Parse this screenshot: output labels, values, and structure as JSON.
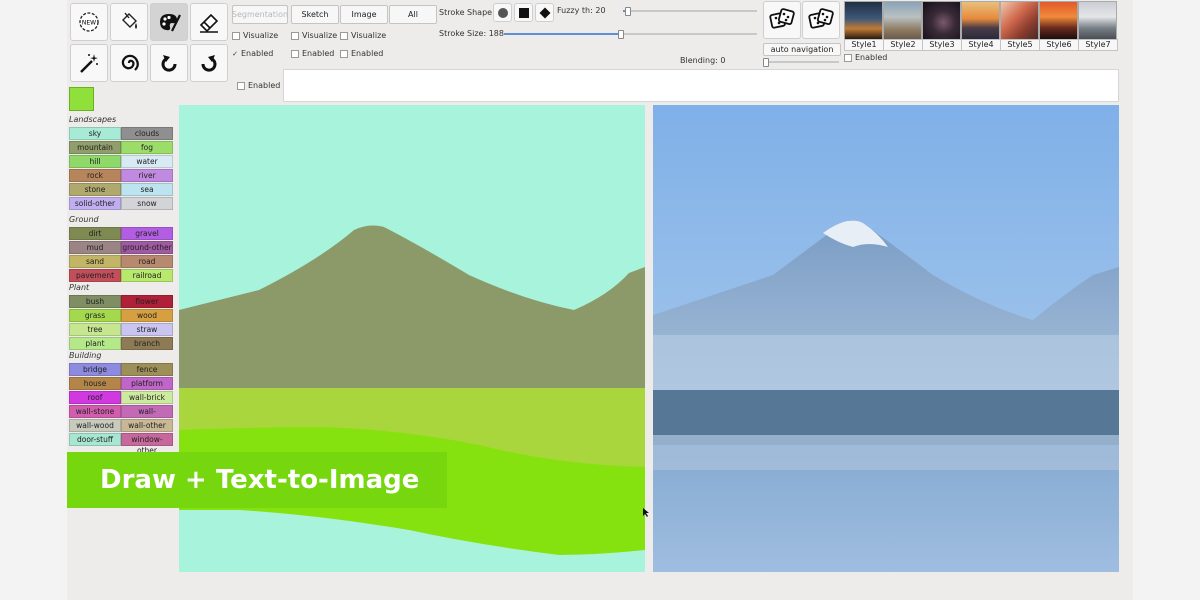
{
  "toolbar": {
    "tools_row1": [
      {
        "name": "new-icon",
        "text": "NEW"
      },
      {
        "name": "fill-bucket-icon"
      },
      {
        "name": "paint-palette-icon"
      },
      {
        "name": "eraser-icon"
      }
    ],
    "tools_row2": [
      {
        "name": "magic-wand-icon"
      },
      {
        "name": "spiral-icon"
      },
      {
        "name": "undo-icon"
      },
      {
        "name": "redo-icon"
      }
    ]
  },
  "modes": {
    "segmentation": "Segmentation",
    "sketch": "Sketch",
    "image": "Image",
    "all": "All"
  },
  "options": {
    "visualize": "Visualize",
    "enabled": "Enabled",
    "check_mark": "✓"
  },
  "stroke": {
    "shape_label": "Stroke Shape",
    "size_label": "Stroke Size: 188",
    "size_fraction": 0.46
  },
  "fuzzy": {
    "label": "Fuzzy th: 20",
    "fraction": 0.03
  },
  "blending": {
    "label": "Blending: 0",
    "fraction": 0.0
  },
  "navigation": {
    "auto_label": "auto navigation",
    "enabled_label": "Enabled"
  },
  "styles": [
    "Style1",
    "Style2",
    "Style3",
    "Style4",
    "Style5",
    "Style6",
    "Style7"
  ],
  "text_prompt": {
    "value": ""
  },
  "current_color": "#8fe03a",
  "palette": {
    "landscapes_title": "Landscapes",
    "landscapes": [
      {
        "label": "sky",
        "color": "#a7ead6"
      },
      {
        "label": "clouds",
        "color": "#8f8f8f"
      },
      {
        "label": "mountain",
        "color": "#8f9e6b"
      },
      {
        "label": "fog",
        "color": "#9cdd6a"
      },
      {
        "label": "hill",
        "color": "#8fd86a"
      },
      {
        "label": "water",
        "color": "#d8ebf4"
      },
      {
        "label": "rock",
        "color": "#b6855b"
      },
      {
        "label": "river",
        "color": "#c08ae0"
      },
      {
        "label": "stone",
        "color": "#b0a96d"
      },
      {
        "label": "sea",
        "color": "#bde3ee"
      },
      {
        "label": "solid-other",
        "color": "#c0aef0"
      },
      {
        "label": "snow",
        "color": "#d2d4d8"
      }
    ],
    "ground_title": "Ground",
    "ground": [
      {
        "label": "dirt",
        "color": "#7f8a52"
      },
      {
        "label": "gravel",
        "color": "#b25ee3"
      },
      {
        "label": "mud",
        "color": "#9a8484"
      },
      {
        "label": "ground-other",
        "color": "#a05aa2"
      },
      {
        "label": "sand",
        "color": "#c2b565"
      },
      {
        "label": "road",
        "color": "#b78a70"
      },
      {
        "label": "pavement",
        "color": "#c24e5a"
      },
      {
        "label": "railroad",
        "color": "#b8e86c"
      }
    ],
    "plant_title": "Plant",
    "plant": [
      {
        "label": "bush",
        "color": "#7f8e63"
      },
      {
        "label": "flower",
        "color": "#b02038"
      },
      {
        "label": "grass",
        "color": "#a5d94d"
      },
      {
        "label": "wood",
        "color": "#d6a040"
      },
      {
        "label": "tree",
        "color": "#c6e78f"
      },
      {
        "label": "straw",
        "color": "#c9c4f0"
      },
      {
        "label": "plant",
        "color": "#b4e889"
      },
      {
        "label": "branch",
        "color": "#8d7b55"
      }
    ],
    "building_title": "Building",
    "building": [
      {
        "label": "bridge",
        "color": "#8d8be0"
      },
      {
        "label": "fence",
        "color": "#9c8f58"
      },
      {
        "label": "house",
        "color": "#b38548"
      },
      {
        "label": "platform",
        "color": "#c066c8"
      },
      {
        "label": "roof",
        "color": "#d039e0"
      },
      {
        "label": "wall-brick",
        "color": "#cdeb9e"
      },
      {
        "label": "wall-stone",
        "color": "#d25cae"
      },
      {
        "label": "wall-concrete",
        "color": "#c26ab6"
      },
      {
        "label": "wall-wood",
        "color": "#c8cabd"
      },
      {
        "label": "wall-other",
        "color": "#c8b895"
      },
      {
        "label": "door-stuff",
        "color": "#a7e6d2"
      },
      {
        "label": "window-other",
        "color": "#c6689c"
      }
    ]
  },
  "banner": {
    "text": "Draw + Text-to-Image"
  }
}
